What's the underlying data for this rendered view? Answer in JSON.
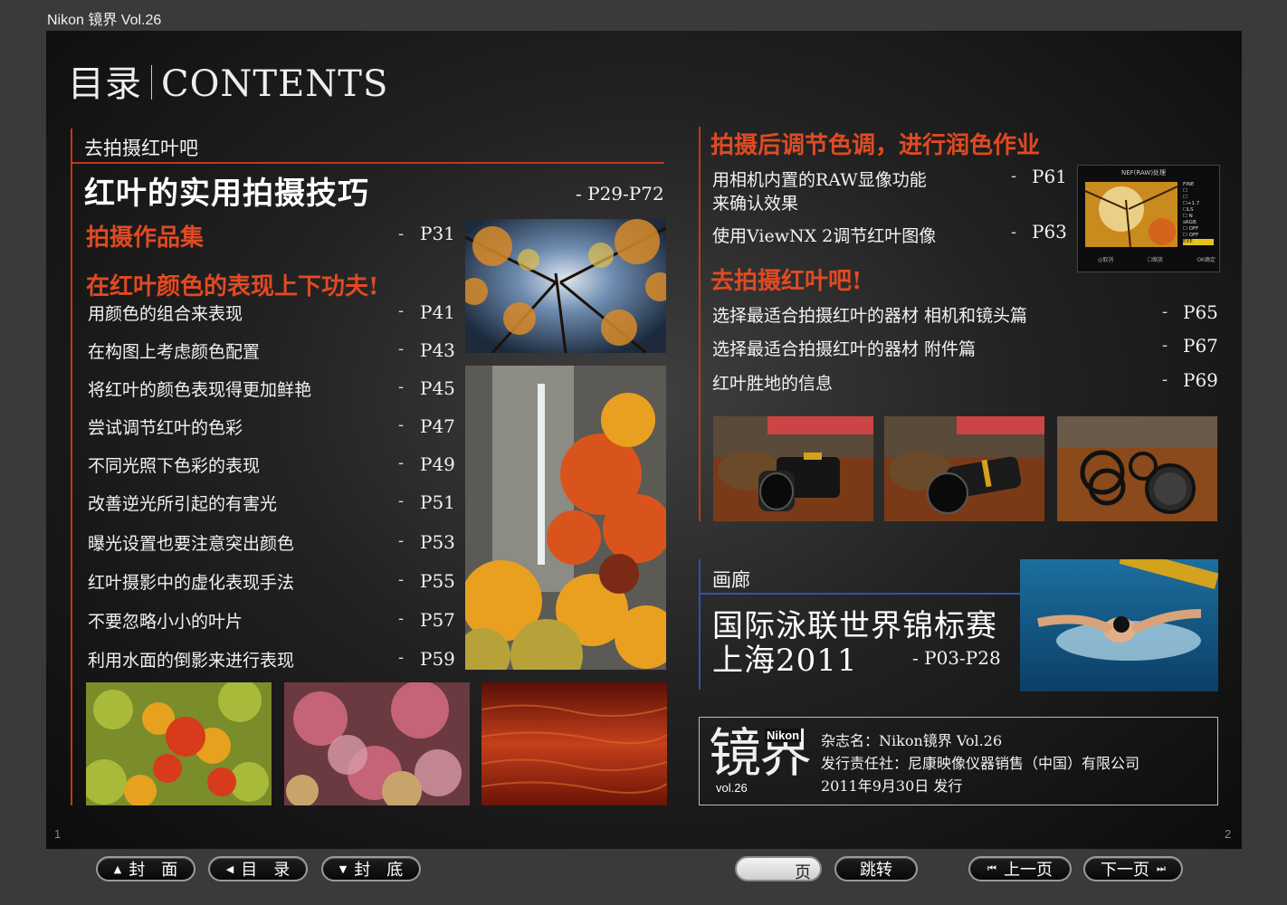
{
  "app": {
    "title": "Nikon 镜界 Vol.26"
  },
  "contents_header": {
    "cn": "目录",
    "en": "CONTENTS"
  },
  "left": {
    "section_label": "去拍摄红叶吧",
    "main_title": "红叶的实用拍摄技巧",
    "main_pages": "- P29-P72",
    "gallery_head": "拍摄作品集",
    "gallery_page": "P31",
    "effort_head": "在红叶颜色的表现上下功夫!",
    "items": [
      {
        "label": "用颜色的组合来表现",
        "page": "P41"
      },
      {
        "label": "在构图上考虑颜色配置",
        "page": "P43"
      },
      {
        "label": "将红叶的颜色表现得更加鲜艳",
        "page": "P45"
      },
      {
        "label": "尝试调节红叶的色彩",
        "page": "P47"
      },
      {
        "label": "不同光照下色彩的表现",
        "page": "P49"
      },
      {
        "label": "改善逆光所引起的有害光",
        "page": "P51"
      },
      {
        "label": "曝光设置也要注意突出颜色",
        "page": "P53"
      },
      {
        "label": "红叶摄影中的虚化表现手法",
        "page": "P55"
      },
      {
        "label": "不要忽略小小的叶片",
        "page": "P57"
      },
      {
        "label": "利用水面的倒影来进行表现",
        "page": "P59"
      }
    ]
  },
  "right": {
    "post_head": "拍摄后调节色调，进行润色作业",
    "post_items": [
      {
        "label": "用相机内置的RAW显像功能",
        "label2": "来确认效果",
        "page": "P61"
      },
      {
        "label": "使用ViewNX 2调节红叶图像",
        "page": "P63"
      }
    ],
    "go_head": "去拍摄红叶吧!",
    "go_items": [
      {
        "label": "选择最适合拍摄红叶的器材 相机和镜头篇",
        "page": "P65"
      },
      {
        "label": "选择最适合拍摄红叶的器材 附件篇",
        "page": "P67"
      },
      {
        "label": "红叶胜地的信息",
        "page": "P69"
      }
    ],
    "lcd": {
      "title": "NEF(RAW)处理",
      "menu": [
        "FINE",
        "☐",
        "☐",
        "☐+1.7",
        "☐LS",
        "☐ N",
        "sRGB",
        "☐ OFF",
        "☐ OFF",
        "EXE"
      ],
      "bottom": [
        "◎取消",
        "☐缩放",
        "OK确定"
      ]
    },
    "gallery_label": "画廊",
    "gallery_title1": "国际泳联世界锦标赛",
    "gallery_title2": "上海2011",
    "gallery_pages": "- P03-P28"
  },
  "imprint": {
    "logo_char": "镜界",
    "logo_brand": "Nikon",
    "logo_vol": "vol.26",
    "line1": "杂志名：Nikon镜界 Vol.26",
    "line2": "发行责任社：尼康映像仪器销售（中国）有限公司",
    "line3": "2011年9月30日 发行"
  },
  "page_numbers": {
    "left": "1",
    "right": "2"
  },
  "toolbar": {
    "cover": "封　面",
    "toc": "目　录",
    "back_cover": "封　底",
    "page_suffix": "页",
    "page_value": "",
    "jump": "跳转",
    "prev": "上一页",
    "next": "下一页"
  },
  "colors": {
    "accent_red": "#e04a22",
    "rule_red": "#c0391b",
    "rule_blue": "#2c55a8"
  }
}
